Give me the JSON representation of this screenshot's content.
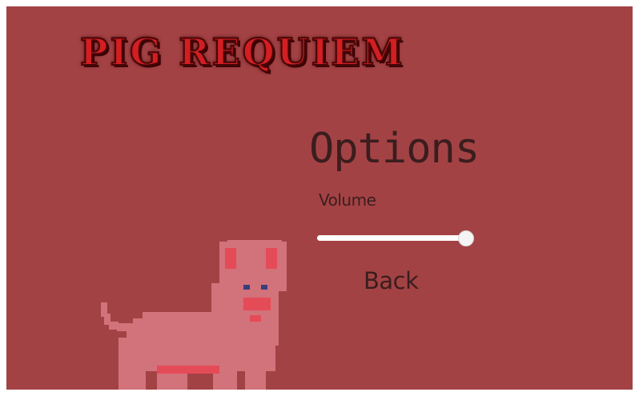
{
  "game": {
    "title": "Pig Requiem"
  },
  "options_menu": {
    "heading": "Options",
    "volume_label": "Volume",
    "volume_level": 1.0,
    "back_label": "Back"
  },
  "icons": {
    "pig": "pixel-pig-icon"
  },
  "colors": {
    "background": "#a34244",
    "title_red": "#d21f22",
    "text_dark": "#3b1d1e",
    "pig_pink": "#d2727a"
  }
}
